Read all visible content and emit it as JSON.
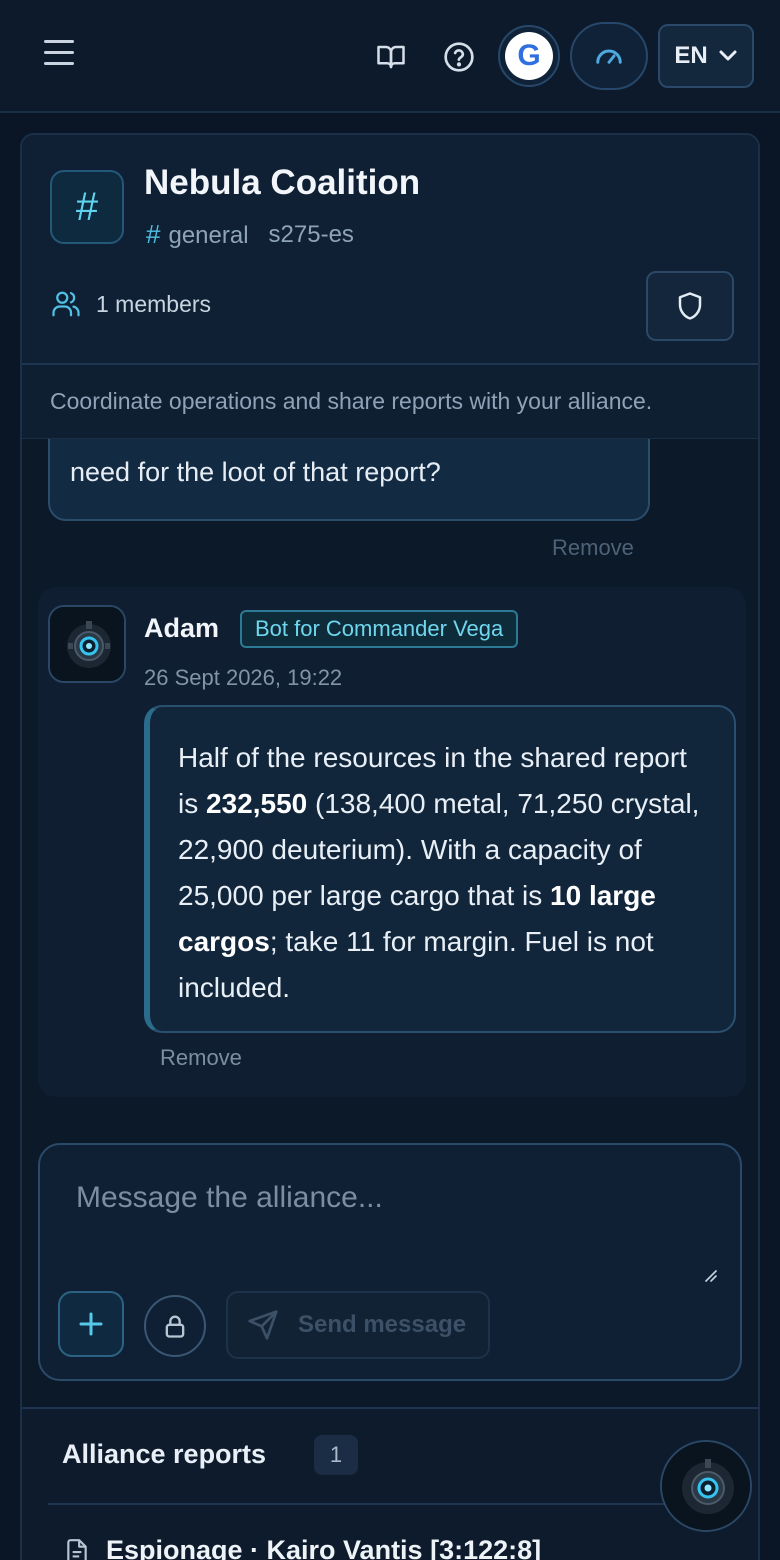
{
  "topbar": {
    "menu_icon": "hamburger-menu-icon",
    "docs_icon": "book-open-icon",
    "help_icon": "help-circle-icon",
    "account_initial": "G",
    "speed_icon": "speedometer-icon",
    "language": "EN",
    "language_icon": "chevron-down-icon"
  },
  "channel": {
    "name": "Nebula Coalition",
    "channel_name": "general",
    "server": "s275-es",
    "members_label": "1 members",
    "description": "Coordinate operations and share reports with your alliance."
  },
  "messages": {
    "previous": {
      "text_tail": "need for the loot of that report?",
      "remove_label": "Remove"
    },
    "bot": {
      "author": "Adam",
      "badge": "Bot for Commander Vega",
      "timestamp": "26 Sept 2026, 19:22",
      "text_1": "Half of the resources in the shared report is ",
      "total": "232,550",
      "text_2": " (138,400 metal, 71,250 crystal, 22,900 deuterium). With a capacity of 25,000 per large cargo that is ",
      "cargos": "10 large cargos",
      "text_3": "; take 11 for margin. Fuel is not included.",
      "remove_label": "Remove"
    }
  },
  "composer": {
    "placeholder": "Message the alliance...",
    "value": "",
    "send_label": "Send message"
  },
  "reports": {
    "title": "Alliance reports",
    "count": "1",
    "items": [
      {
        "label": "Espionage · Kairo Vantis [3:122:8]",
        "icon": "document-icon"
      }
    ]
  },
  "colors": {
    "background": "#0a1626",
    "accent": "#4fc1e3",
    "badge_border": "#2c7a93"
  }
}
